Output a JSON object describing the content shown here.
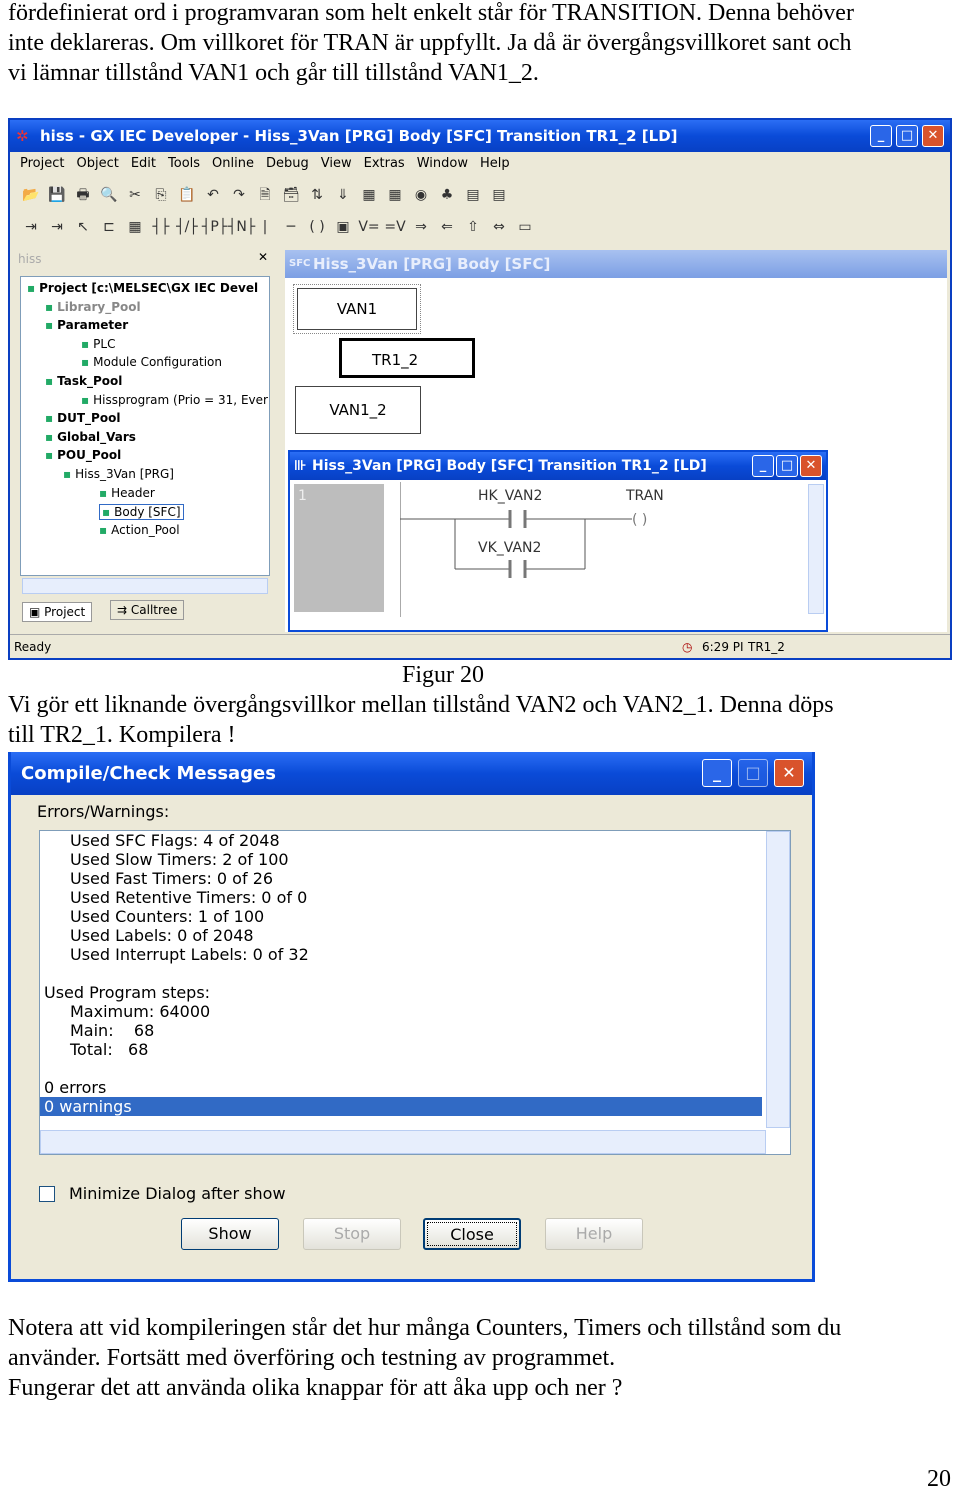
{
  "intro": [
    "fördefinierat ord i programvaran som helt enkelt står för TRANSITION. Denna behöver",
    "inte deklareras. Om villkoret för TRAN är uppfyllt. Ja då är övergångsvillkoret sant och",
    "vi lämnar tillstånd VAN1 och går till tillstånd VAN1_2."
  ],
  "app": {
    "title": "hiss - GX IEC Developer - Hiss_3Van [PRG] Body [SFC] Transition TR1_2 [LD]",
    "menu": [
      "Project",
      "Object",
      "Edit",
      "Tools",
      "Online",
      "Debug",
      "View",
      "Extras",
      "Window",
      "Help"
    ],
    "toolbar1": [
      "open-icon",
      "save-icon",
      "print-icon",
      "print-preview-icon",
      "cut-icon",
      "copy-icon",
      "paste-icon",
      "undo-icon",
      "redo-icon",
      "properties-icon",
      "archive-icon",
      "transfer-icon",
      "download-icon",
      "monitor-icon",
      "monitor2-icon",
      "compile-icon",
      "build-icon",
      "network-icon",
      "network2-icon"
    ],
    "toolbar2": [
      "insert-row-icon",
      "insert-col-icon",
      "select-arrow-icon",
      "line-icon",
      "fb-icon",
      "contact-no-icon",
      "contact-nc-icon",
      "contact-rise-icon",
      "contact-fall-icon",
      "line-vertical-icon",
      "horizontal-line-icon",
      "coil-icon",
      "function-block-icon",
      "var-in-icon",
      "var-out-icon",
      "jump-icon",
      "return-icon",
      "up-icon",
      "left-right-icon",
      "comment-icon"
    ],
    "toolbar1_glyphs": [
      "📂",
      "💾",
      "🖶",
      "🔍",
      "✂",
      "⎘",
      "📋",
      "↶",
      "↷",
      "🗎",
      "🗃",
      "⇅",
      "⇓",
      "▦",
      "▦",
      "◉",
      "♣",
      "▤",
      "▤"
    ],
    "toolbar2_glyphs": [
      "⇥",
      "⇥",
      "↖",
      "⊏",
      "▦",
      "┤├",
      "┤/├",
      "┤P├",
      "┤N├",
      "|",
      "─",
      "( )",
      "▣",
      "V=",
      "=V",
      "⇒",
      "⇐",
      "⇧",
      "⇔",
      "▭"
    ],
    "tree": {
      "panel_title": "hiss",
      "items": [
        {
          "label": "Project [c:\\MELSEC\\GX IEC Devel",
          "bold": true
        },
        {
          "label": "Library_Pool",
          "bold": true
        },
        {
          "label": "Parameter",
          "bold": true
        },
        {
          "label": "PLC"
        },
        {
          "label": "Module Configuration"
        },
        {
          "label": "Task_Pool",
          "bold": true
        },
        {
          "label": "Hissprogram (Prio = 31, Ever"
        },
        {
          "label": "DUT_Pool",
          "bold": true
        },
        {
          "label": "Global_Vars",
          "bold": true
        },
        {
          "label": "POU_Pool",
          "bold": true
        },
        {
          "label": "Hiss_3Van [PRG]"
        },
        {
          "label": "Header"
        },
        {
          "label": "Body [SFC]"
        },
        {
          "label": "Action_Pool"
        }
      ],
      "tabs": [
        "Project",
        "Calltree"
      ]
    },
    "sfc": {
      "title": "Hiss_3Van [PRG] Body [SFC]",
      "step1": "VAN1",
      "transition": "TR1_2",
      "step2": "VAN1_2"
    },
    "ld": {
      "title": "Hiss_3Van [PRG] Body [SFC] Transition TR1_2 [LD]",
      "network": "1",
      "contact1": "HK_VAN2",
      "contact2": "VK_VAN2",
      "coil": "TRAN"
    },
    "status": {
      "text": "Ready",
      "time": "6:29 PI",
      "object": "TR1_2"
    }
  },
  "caption": "Figur 20",
  "mid": [
    "Vi gör ett liknande övergångsvillkor mellan tillstånd VAN2 och VAN2_1. Denna döps",
    "till TR2_1. Kompilera !"
  ],
  "dialog": {
    "title": "Compile/Check Messages",
    "group_label": "Errors/Warnings:",
    "lines": [
      "Used SFC Flags: 4 of 2048",
      "Used Slow Timers: 2 of 100",
      "Used Fast Timers: 0 of 26",
      "Used Retentive Timers: 0 of 0",
      "Used Counters: 1 of 100",
      "Used Labels: 0 of 2048",
      "Used Interrupt Labels: 0 of 32",
      "Used Program steps:",
      "Maximum: 64000",
      "Main:    68",
      "Total:   68",
      "0 errors",
      "0 warnings"
    ],
    "checkbox_label": "Minimize  Dialog after show",
    "checkbox_checked": false,
    "buttons": {
      "show": "Show",
      "stop": "Stop",
      "close": "Close",
      "help": "Help"
    }
  },
  "outro": [
    "Notera att vid kompileringen står det hur många Counters, Timers och tillstånd som du",
    "använder. Fortsätt med överföring och testning av programmet.",
    "Fungerar det att använda olika knappar för att åka upp och ner ?"
  ],
  "page_number": "20"
}
